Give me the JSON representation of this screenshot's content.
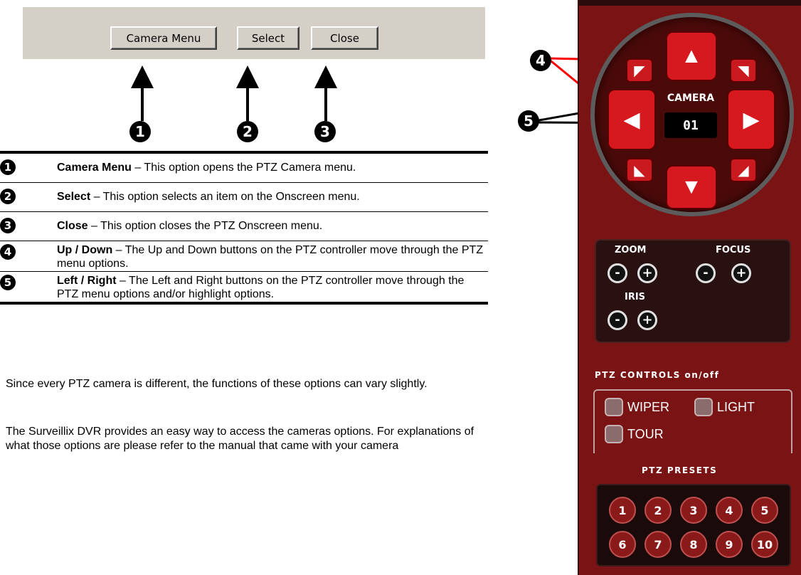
{
  "toolbar": {
    "camera_menu": "Camera Menu",
    "select": "Select",
    "close": "Close"
  },
  "callouts": [
    "1",
    "2",
    "3",
    "4",
    "5"
  ],
  "legend": [
    {
      "num": "1",
      "term": "Camera Menu",
      "desc": " – This option opens the PTZ Camera menu."
    },
    {
      "num": "2",
      "term": "Select",
      "desc": " – This option selects an item on the Onscreen menu."
    },
    {
      "num": "3",
      "term": "Close",
      "desc": " – This option closes the PTZ Onscreen menu."
    },
    {
      "num": "4",
      "term": "Up / Down",
      "desc": " – The Up and Down buttons on the PTZ controller move through the PTZ menu options."
    },
    {
      "num": "5",
      "term": "Left / Right",
      "desc": " – The Left and Right buttons on the PTZ controller move through the PTZ menu options and/or highlight options."
    }
  ],
  "paragraphs": [
    "Since every PTZ camera is different, the functions of these options can vary slightly.",
    "The Surveillix DVR provides an easy way to access the cameras options. For explanations of what those options are please refer to the manual that came with your camera"
  ],
  "ptz": {
    "camera_label": "CAMERA",
    "camera_number": "01",
    "zoom_label": "ZOOM",
    "focus_label": "FOCUS",
    "iris_label": "IRIS",
    "minus": "-",
    "plus": "+",
    "controls_label": "PTZ CONTROLS on/off",
    "wiper": "WIPER",
    "light": "LIGHT",
    "tour": "TOUR",
    "presets_label": "PTZ PRESETS",
    "presets": [
      "1",
      "2",
      "3",
      "4",
      "5",
      "6",
      "7",
      "8",
      "9",
      "10"
    ]
  },
  "colors": {
    "panel_red": "#7a1414",
    "button_red": "#d6191f",
    "callout_red": "#ff0000",
    "toolbar_gray": "#d4d0c8"
  }
}
